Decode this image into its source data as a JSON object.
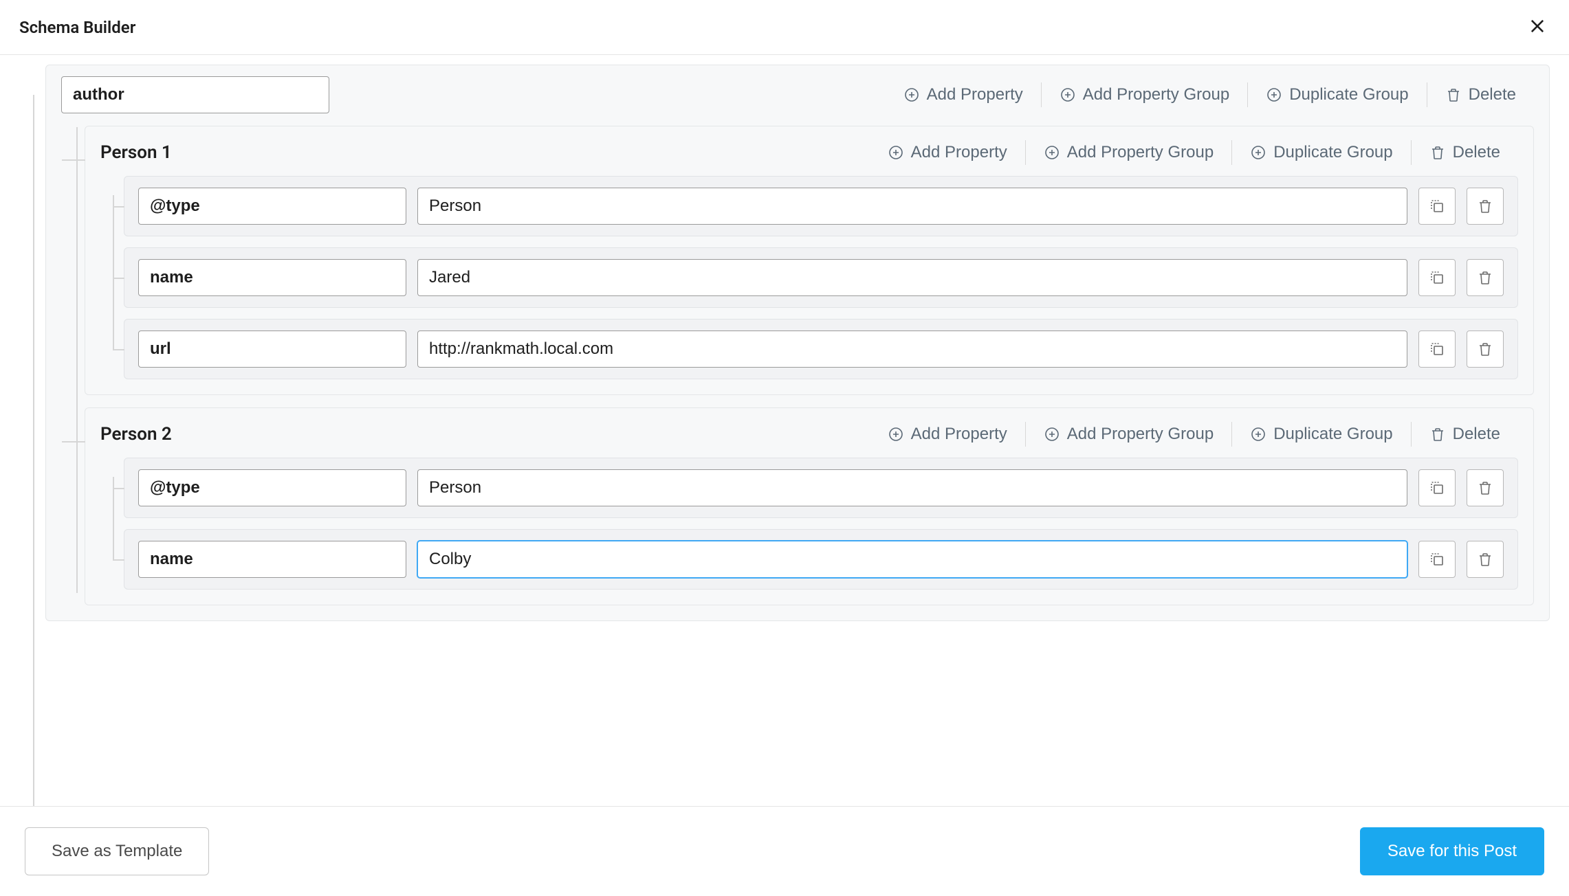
{
  "header": {
    "title": "Schema Builder"
  },
  "topGroup": {
    "name": "author",
    "actions": {
      "addProperty": "Add Property",
      "addPropertyGroup": "Add Property Group",
      "duplicateGroup": "Duplicate Group",
      "delete": "Delete"
    }
  },
  "subgroups": [
    {
      "title": "Person 1",
      "actions": {
        "addProperty": "Add Property",
        "addPropertyGroup": "Add Property Group",
        "duplicateGroup": "Duplicate Group",
        "delete": "Delete"
      },
      "rows": [
        {
          "key": "@type",
          "value": "Person",
          "focused": false
        },
        {
          "key": "name",
          "value": "Jared",
          "focused": false
        },
        {
          "key": "url",
          "value": "http://rankmath.local.com",
          "focused": false
        }
      ]
    },
    {
      "title": "Person 2",
      "actions": {
        "addProperty": "Add Property",
        "addPropertyGroup": "Add Property Group",
        "duplicateGroup": "Duplicate Group",
        "delete": "Delete"
      },
      "rows": [
        {
          "key": "@type",
          "value": "Person",
          "focused": false
        },
        {
          "key": "name",
          "value": "Colby",
          "focused": true
        }
      ]
    }
  ],
  "footer": {
    "saveTemplate": "Save as Template",
    "savePost": "Save for this Post"
  }
}
